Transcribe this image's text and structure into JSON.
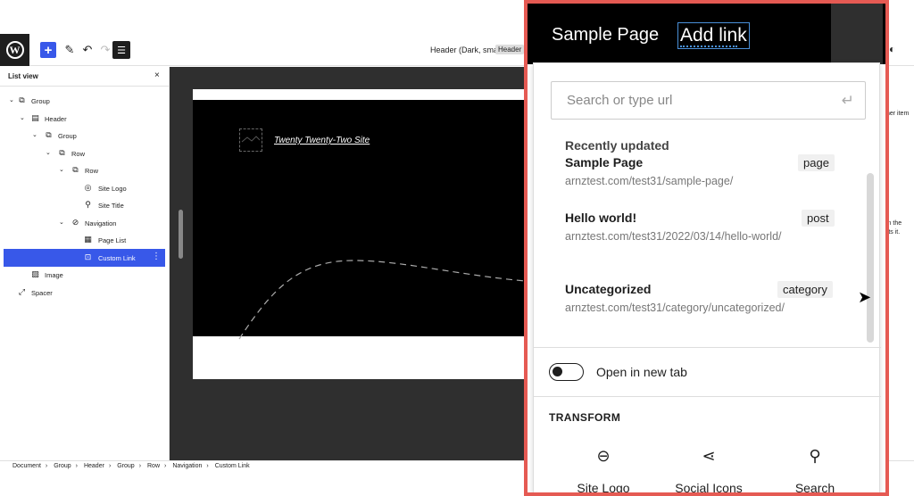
{
  "toolbar": {
    "logo_text": "W",
    "add_icon": "+",
    "edit_icon": "✎",
    "undo_icon": "↶",
    "redo_icon": "↷",
    "listview_icon": "☰",
    "doc_title": "Header (Dark, small)",
    "doc_badge": "Header",
    "style_icon": "◐"
  },
  "listview": {
    "title": "List view",
    "close": "×",
    "items": [
      {
        "label": "Group",
        "icon": "⧉"
      },
      {
        "label": "Header",
        "icon": "▤"
      },
      {
        "label": "Group",
        "icon": "⧉"
      },
      {
        "label": "Row",
        "icon": "⧉"
      },
      {
        "label": "Row",
        "icon": "⧉"
      },
      {
        "label": "Site Logo",
        "icon": "◎"
      },
      {
        "label": "Site Title",
        "icon": "⚲"
      },
      {
        "label": "Navigation",
        "icon": "⊘"
      },
      {
        "label": "Page List",
        "icon": "▦"
      },
      {
        "label": "Custom Link",
        "icon": "⊡"
      },
      {
        "label": "Image",
        "icon": "▨"
      },
      {
        "label": "Spacer",
        "icon": "⤢"
      }
    ],
    "more": "⋮"
  },
  "canvas": {
    "site_title": "Twenty Twenty-Two Site"
  },
  "rsidebar": {
    "text1": "her item",
    "text2": "in the",
    "text3": "rts it."
  },
  "breadcrumb": [
    "Document",
    "Group",
    "Header",
    "Group",
    "Row",
    "Navigation",
    "Custom Link"
  ],
  "zoom": {
    "nav_item": "Sample Page",
    "add_link": "Add link",
    "search_placeholder": "Search or type url",
    "enter_icon": "↵",
    "recent_label": "Recently updated",
    "results": [
      {
        "title": "Sample Page",
        "url": "arnztest.com/test31/sample-page/",
        "type": "page"
      },
      {
        "title": "Hello world!",
        "url": "arnztest.com/test31/2022/03/14/hello-world/",
        "type": "post"
      },
      {
        "title": "Uncategorized",
        "url": "arnztest.com/test31/category/uncategorized/",
        "type": "category"
      }
    ],
    "open_new_tab": "Open in new tab",
    "transform_label": "TRANSFORM",
    "transforms": [
      {
        "label": "Site Logo",
        "icon": "⊖"
      },
      {
        "label": "Social Icons",
        "icon": "⋖"
      },
      {
        "label": "Search",
        "icon": "⚲"
      }
    ],
    "cursor": "➤"
  }
}
